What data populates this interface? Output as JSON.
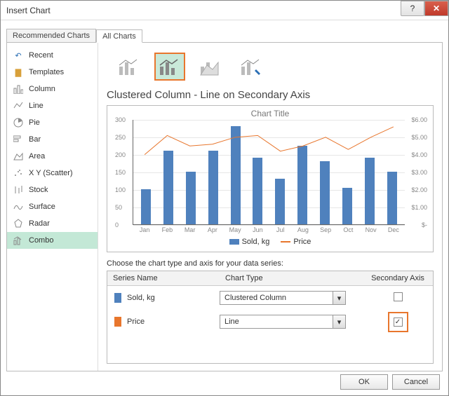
{
  "window": {
    "title": "Insert Chart",
    "ok": "OK",
    "cancel": "Cancel"
  },
  "tabs": {
    "rec": "Recommended Charts",
    "all": "All Charts"
  },
  "sidebar": {
    "items": [
      {
        "label": "Recent"
      },
      {
        "label": "Templates"
      },
      {
        "label": "Column"
      },
      {
        "label": "Line"
      },
      {
        "label": "Pie"
      },
      {
        "label": "Bar"
      },
      {
        "label": "Area"
      },
      {
        "label": "X Y (Scatter)"
      },
      {
        "label": "Stock"
      },
      {
        "label": "Surface"
      },
      {
        "label": "Radar"
      },
      {
        "label": "Combo"
      }
    ]
  },
  "variant_heading": "Clustered Column - Line on Secondary Axis",
  "chart": {
    "title": "Chart Title"
  },
  "legend": {
    "a": "Sold, kg",
    "b": "Price"
  },
  "subhead": "Choose the chart type and axis for your data series:",
  "cols": {
    "name": "Series Name",
    "type": "Chart Type",
    "sec": "Secondary Axis"
  },
  "series": [
    {
      "name": "Sold, kg",
      "type": "Clustered Column",
      "secondary": false,
      "color": "#4f81bd"
    },
    {
      "name": "Price",
      "type": "Line",
      "secondary": true,
      "color": "#e8762d"
    }
  ],
  "chart_data": {
    "type": "combo",
    "categories": [
      "Jan",
      "Feb",
      "Mar",
      "Apr",
      "May",
      "Jun",
      "Jul",
      "Aug",
      "Sep",
      "Oct",
      "Nov",
      "Dec"
    ],
    "series": [
      {
        "name": "Sold, kg",
        "type": "bar",
        "axis": "primary",
        "values": [
          100,
          210,
          150,
          210,
          280,
          190,
          130,
          225,
          180,
          105,
          190,
          150
        ]
      },
      {
        "name": "Price",
        "type": "line",
        "axis": "secondary",
        "values": [
          4.0,
          5.1,
          4.5,
          4.6,
          5.0,
          5.1,
          4.2,
          4.5,
          5.0,
          4.3,
          5.0,
          5.6
        ]
      }
    ],
    "ylim": [
      0,
      300
    ],
    "yticks": [
      0,
      50,
      100,
      150,
      200,
      250,
      300
    ],
    "y2lim": [
      0,
      6
    ],
    "y2ticks": [
      "$-",
      "$1.00",
      "$2.00",
      "$3.00",
      "$4.00",
      "$5.00",
      "$6.00"
    ],
    "legend_position": "bottom"
  }
}
